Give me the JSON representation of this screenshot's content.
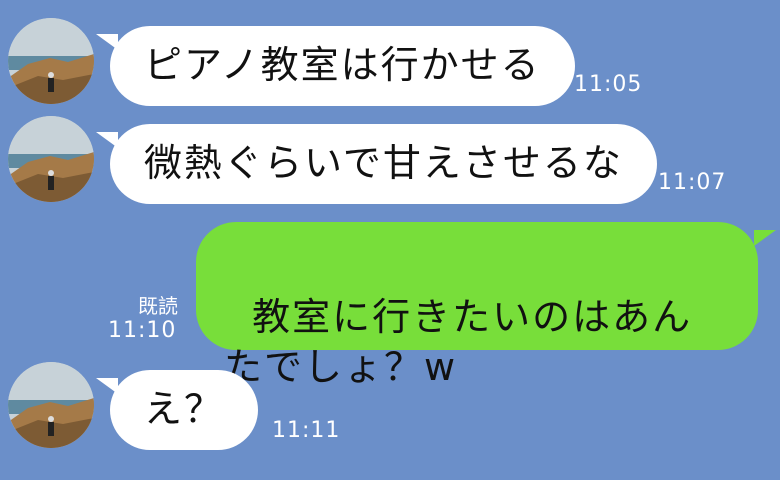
{
  "messages": [
    {
      "sender": "other",
      "text": "ピアノ教室は行かせる",
      "time": "11:05"
    },
    {
      "sender": "other",
      "text": "微熱ぐらいで甘えさせるな",
      "time": "11:07"
    },
    {
      "sender": "me",
      "text": "教室に行きたいのはあんたでしょ？w",
      "time": "11:10",
      "read_label": "既読"
    },
    {
      "sender": "other",
      "text": "え？",
      "time": "11:11"
    }
  ],
  "colors": {
    "background": "#6b8fc9",
    "incoming_bubble": "#ffffff",
    "outgoing_bubble": "#78de3a",
    "timestamp": "#ffffff"
  },
  "icons": {
    "avatar": "profile-photo-icon"
  }
}
